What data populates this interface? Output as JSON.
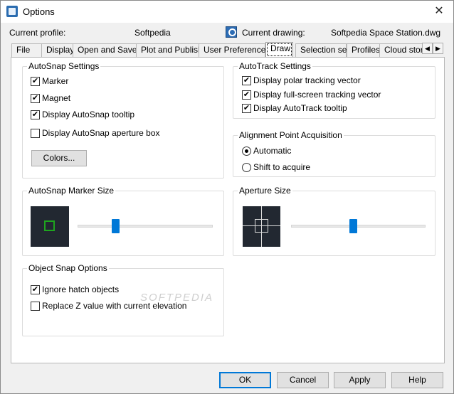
{
  "window": {
    "title": "Options",
    "close_glyph": "✕"
  },
  "header": {
    "profile_label": "Current profile:",
    "profile_value": "Softpedia",
    "drawing_label": "Current drawing:",
    "drawing_value": "Softpedia Space Station.dwg"
  },
  "tabs": [
    {
      "label": "File"
    },
    {
      "label": "Display"
    },
    {
      "label": "Open and Save"
    },
    {
      "label": "Plot and Publish"
    },
    {
      "label": "User Preferences"
    },
    {
      "label": "Draw",
      "active": true
    },
    {
      "label": "Selection set"
    },
    {
      "label": "Profiles"
    },
    {
      "label": "Cloud stora"
    }
  ],
  "tab_scroll": {
    "left": "◀",
    "right": "▶"
  },
  "autosnap": {
    "title": "AutoSnap Settings",
    "options": [
      {
        "label": "Marker",
        "checked": true
      },
      {
        "label": "Magnet",
        "checked": true
      },
      {
        "label": "Display AutoSnap tooltip",
        "checked": true
      },
      {
        "label": "Display AutoSnap aperture box",
        "checked": false
      }
    ],
    "colors_button": "Colors..."
  },
  "autotrack": {
    "title": "AutoTrack Settings",
    "options": [
      {
        "label": "Display polar tracking vector",
        "checked": true
      },
      {
        "label": "Display full-screen tracking vector",
        "checked": true
      },
      {
        "label": "Display AutoTrack tooltip",
        "checked": true
      }
    ]
  },
  "alignment": {
    "title": "Alignment Point Acquisition",
    "options": [
      {
        "label": "Automatic",
        "selected": true
      },
      {
        "label": "Shift to acquire",
        "selected": false
      }
    ]
  },
  "marker_size": {
    "title": "AutoSnap Marker Size",
    "value": 0.27,
    "marker_color": "#1ea51e"
  },
  "aperture_size": {
    "title": "Aperture Size",
    "value": 0.46
  },
  "object_snap": {
    "title": "Object Snap Options",
    "options": [
      {
        "label": "Ignore hatch objects",
        "checked": true
      },
      {
        "label": "Replace Z value with current elevation",
        "checked": false
      }
    ]
  },
  "watermark": "SOFTPEDIA",
  "footer": {
    "ok": "OK",
    "cancel": "Cancel",
    "apply": "Apply",
    "help": "Help"
  },
  "colors": {
    "accent": "#0078d7",
    "check_glyph": "✔"
  }
}
